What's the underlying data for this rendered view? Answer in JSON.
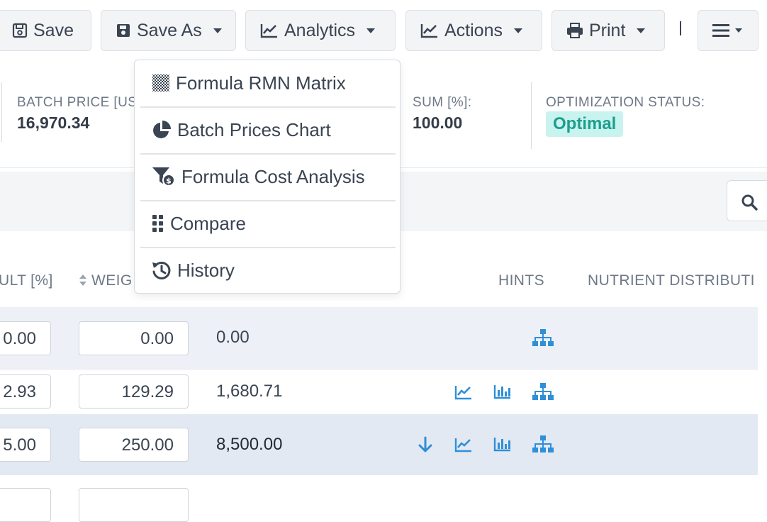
{
  "toolbar": {
    "save_label": "Save",
    "save_as_label": "Save As",
    "analytics_label": "Analytics",
    "actions_label": "Actions",
    "print_label": "Print"
  },
  "summary": {
    "batch_price_label": "BATCH PRICE [US",
    "batch_price_value": "16,970.34",
    "sum_label": "SUM [%]:",
    "sum_value": "100.00",
    "status_label": "OPTIMIZATION STATUS:",
    "status_value": "Optimal"
  },
  "analytics_menu": {
    "items": [
      {
        "label": "Formula RMN Matrix",
        "icon": "checker-icon"
      },
      {
        "label": "Batch Prices Chart",
        "icon": "pie-chart-icon"
      },
      {
        "label": "Formula Cost Analysis",
        "icon": "funnel-dollar-icon"
      },
      {
        "label": "Compare",
        "icon": "grid-dots-icon"
      },
      {
        "label": "History",
        "icon": "history-icon"
      }
    ]
  },
  "table": {
    "headers": {
      "result": "ULT [%]",
      "weight": "WEIG",
      "hints": "HINTS",
      "nutrient": "NUTRIENT DISTRIBUTI"
    },
    "rows": [
      {
        "result": "0.00",
        "weight": "0.00",
        "price": "0.00",
        "icons": [
          "hierarchy-icon"
        ]
      },
      {
        "result": "2.93",
        "weight": "129.29",
        "price": "1,680.71",
        "icons": [
          "line-chart-icon",
          "bar-chart-icon",
          "hierarchy-icon"
        ]
      },
      {
        "result": "5.00",
        "weight": "250.00",
        "price": "8,500.00",
        "icons": [
          "arrow-down-icon",
          "line-chart-icon",
          "bar-chart-icon",
          "hierarchy-icon"
        ]
      }
    ]
  },
  "colors": {
    "accent_blue": "#2f8fd8",
    "status_teal": "#1f9d8f",
    "status_bg": "#c8f3ef",
    "row_highlight": "#edf1f7"
  }
}
